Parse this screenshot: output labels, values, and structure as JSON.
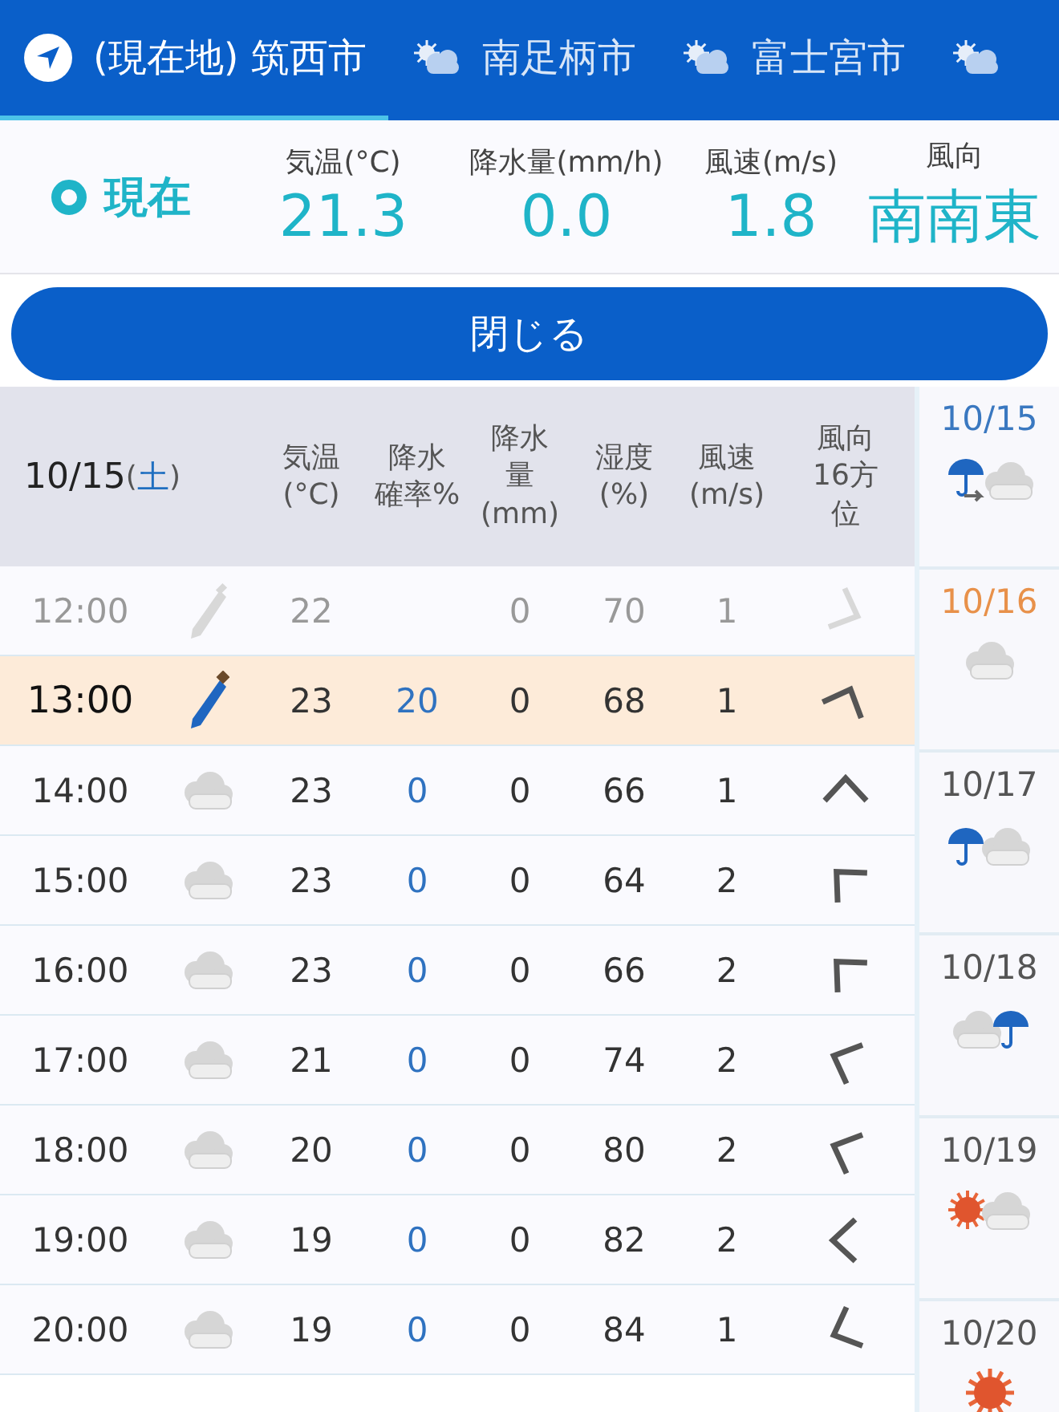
{
  "tabs": [
    {
      "kind": "location",
      "label": "(現在地) 筑西市",
      "selected": true
    },
    {
      "kind": "weather",
      "label": "南足柄市",
      "selected": false
    },
    {
      "kind": "weather",
      "label": "富士宮市",
      "selected": false
    },
    {
      "kind": "weather",
      "selected": false
    }
  ],
  "current": {
    "label": "現在",
    "metrics": [
      {
        "label": "気温(°C)",
        "value": "21.3"
      },
      {
        "label": "降水量(mm/h)",
        "value": "0.0"
      },
      {
        "label": "風速(m/s)",
        "value": "1.8"
      },
      {
        "label": "風向",
        "value": "南南東"
      }
    ]
  },
  "close_button": "閉じる",
  "table": {
    "date": "10/15",
    "paren_open": "(",
    "weekday": "土",
    "paren_close": ")",
    "columns": [
      [
        "気温",
        "(°C)"
      ],
      [
        "降水",
        "確率%"
      ],
      [
        "降水",
        "量",
        "(mm)"
      ],
      [
        "湿度",
        "(%)"
      ],
      [
        "風速",
        "(m/s)"
      ],
      [
        "風向",
        "16方",
        "位"
      ]
    ],
    "rows": [
      {
        "past": true,
        "selected": false,
        "kind": "umbrella",
        "time": "12:00",
        "temp": "22",
        "amount": "0",
        "humidity": "70",
        "speed": "1",
        "wind": {
          "kind": "ese"
        }
      },
      {
        "past": false,
        "selected": true,
        "kind": "umbrella",
        "time": "13:00",
        "temp": "23",
        "prob": "20",
        "amount": "0",
        "humidity": "68",
        "speed": "1",
        "wind": {
          "kind": "nne"
        }
      },
      {
        "past": false,
        "selected": false,
        "kind": "cloud",
        "time": "14:00",
        "temp": "23",
        "prob": "0",
        "amount": "0",
        "humidity": "66",
        "speed": "1",
        "wind": {
          "kind": "n"
        }
      },
      {
        "past": false,
        "selected": false,
        "kind": "cloud",
        "time": "15:00",
        "temp": "23",
        "prob": "0",
        "amount": "0",
        "humidity": "64",
        "speed": "2",
        "wind": {
          "kind": "nw"
        }
      },
      {
        "past": false,
        "selected": false,
        "kind": "cloud",
        "time": "16:00",
        "temp": "23",
        "prob": "0",
        "amount": "0",
        "humidity": "66",
        "speed": "2",
        "wind": {
          "kind": "nw"
        }
      },
      {
        "past": false,
        "selected": false,
        "kind": "cloud",
        "time": "17:00",
        "temp": "21",
        "prob": "0",
        "amount": "0",
        "humidity": "74",
        "speed": "2",
        "wind": {
          "kind": "wnw"
        }
      },
      {
        "past": false,
        "selected": false,
        "kind": "cloud",
        "time": "18:00",
        "temp": "20",
        "prob": "0",
        "amount": "0",
        "humidity": "80",
        "speed": "2",
        "wind": {
          "kind": "wnw"
        }
      },
      {
        "past": false,
        "selected": false,
        "kind": "cloud",
        "time": "19:00",
        "temp": "19",
        "prob": "0",
        "amount": "0",
        "humidity": "82",
        "speed": "2",
        "wind": {
          "kind": "w"
        }
      },
      {
        "past": false,
        "selected": false,
        "kind": "cloud",
        "time": "20:00",
        "temp": "19",
        "prob": "0",
        "amount": "0",
        "humidity": "84",
        "speed": "1",
        "wind": {
          "kind": "wsw"
        }
      }
    ]
  },
  "days": [
    {
      "date": "10/15",
      "color": "#3a78c0",
      "kind": "rain_to_cloud"
    },
    {
      "date": "10/16",
      "color": "#e8914a",
      "kind": "cloud"
    },
    {
      "date": "10/17",
      "color": "#555555",
      "kind": "rain_cloud"
    },
    {
      "date": "10/18",
      "color": "#555555",
      "kind": "cloud_rain"
    },
    {
      "date": "10/19",
      "color": "#555555",
      "kind": "sun_cloud"
    },
    {
      "date": "10/20",
      "color": "#555555",
      "kind": "sun"
    }
  ]
}
